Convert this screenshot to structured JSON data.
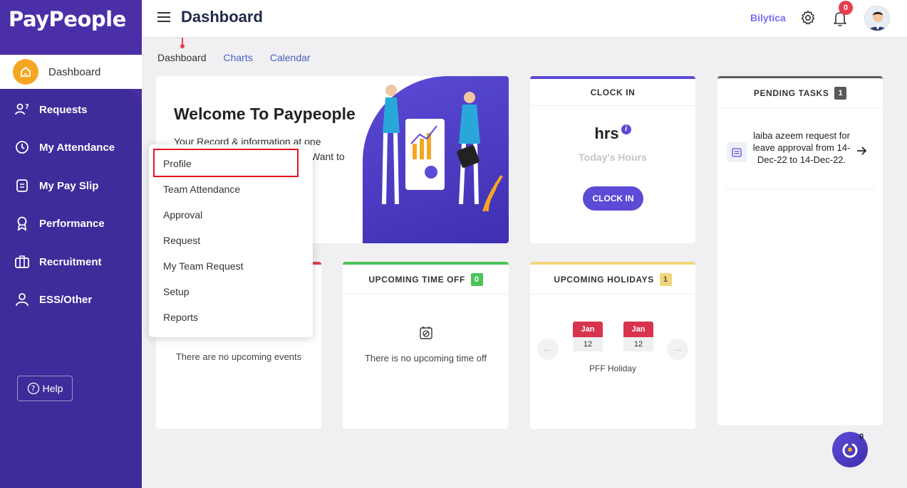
{
  "app": {
    "logo": "PayPeople"
  },
  "sidebar": {
    "items": [
      {
        "label": "Dashboard",
        "icon": "home-icon",
        "active": true
      },
      {
        "label": "Requests",
        "icon": "requests-icon"
      },
      {
        "label": "My Attendance",
        "icon": "clock-icon"
      },
      {
        "label": "My Pay Slip",
        "icon": "payslip-icon"
      },
      {
        "label": "Performance",
        "icon": "award-icon"
      },
      {
        "label": "Recruitment",
        "icon": "briefcase-icon"
      },
      {
        "label": "ESS/Other",
        "icon": "user-icon"
      }
    ],
    "help_label": "Help"
  },
  "header": {
    "title": "Dashboard",
    "company": "Bilytica",
    "notification_count": "0"
  },
  "tabs": [
    {
      "label": "Dashboard",
      "active": true
    },
    {
      "label": "Charts"
    },
    {
      "label": "Calendar"
    }
  ],
  "welcome": {
    "title": "Welcome To Paypeople",
    "text_line1": "Your Record & information at one",
    "text_line2": "Want to"
  },
  "clock_in": {
    "title": "CLOCK IN",
    "hours": "hrs",
    "today_label": "Today's Hours",
    "button": "CLOCK IN"
  },
  "pending_tasks": {
    "title": "PENDING TASKS",
    "count": "1",
    "tasks": [
      {
        "text": "laiba azeem request for leave approval from 14-Dec-22 to 14-Dec-22."
      }
    ]
  },
  "events": {
    "empty_text": "There are no upcoming events"
  },
  "upcoming_time_off": {
    "title": "UPCOMING TIME OFF",
    "count": "0",
    "empty_text": "There is no upcoming time off"
  },
  "upcoming_holidays": {
    "title": "UPCOMING HOLIDAYS",
    "count": "1",
    "dates": [
      {
        "month": "Jan",
        "day": "12"
      },
      {
        "month": "Jan",
        "day": "12"
      }
    ],
    "name": "PFF Holiday"
  },
  "dropdown": {
    "items": [
      "Profile",
      "Team Attendance",
      "Approval",
      "Request",
      "My Team Request",
      "Setup",
      "Reports"
    ]
  },
  "fab": {
    "count": "0"
  },
  "colors": {
    "sidebar": "#3f2b99",
    "accent": "#5b4bd6",
    "active_icon": "#f5a623",
    "danger": "#e53e4f",
    "success": "#4cc35a",
    "warning": "#f2d57a"
  }
}
